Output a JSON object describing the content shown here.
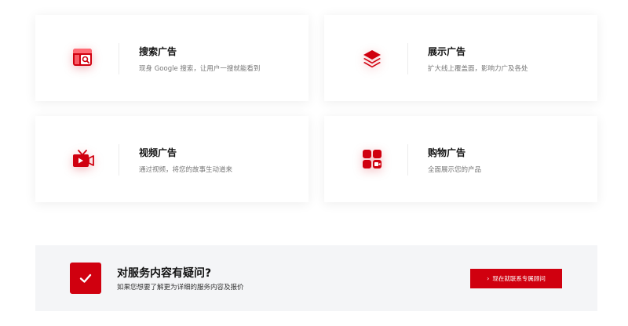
{
  "colors": {
    "accent": "#d0000f",
    "panel_bg": "#f4f5f7"
  },
  "services": [
    {
      "title": "搜索广告",
      "description": "现身 Google 搜索，让用户一搜就能看到",
      "icon": "search-ad-icon"
    },
    {
      "title": "展示广告",
      "description": "扩大线上覆盖面，影响力广及各处",
      "icon": "layers-icon"
    },
    {
      "title": "视频广告",
      "description": "通过视频，将您的故事生动道来",
      "icon": "tv-video-icon"
    },
    {
      "title": "购物广告",
      "description": "全面展示您的产品",
      "icon": "apps-grid-icon"
    }
  ],
  "cta": {
    "title": "对服务内容有疑问?",
    "subtitle": "如果您想要了解更为详细的服务内容及报价",
    "button_label": "现在就联系专属顾问",
    "icon": "check-icon"
  }
}
